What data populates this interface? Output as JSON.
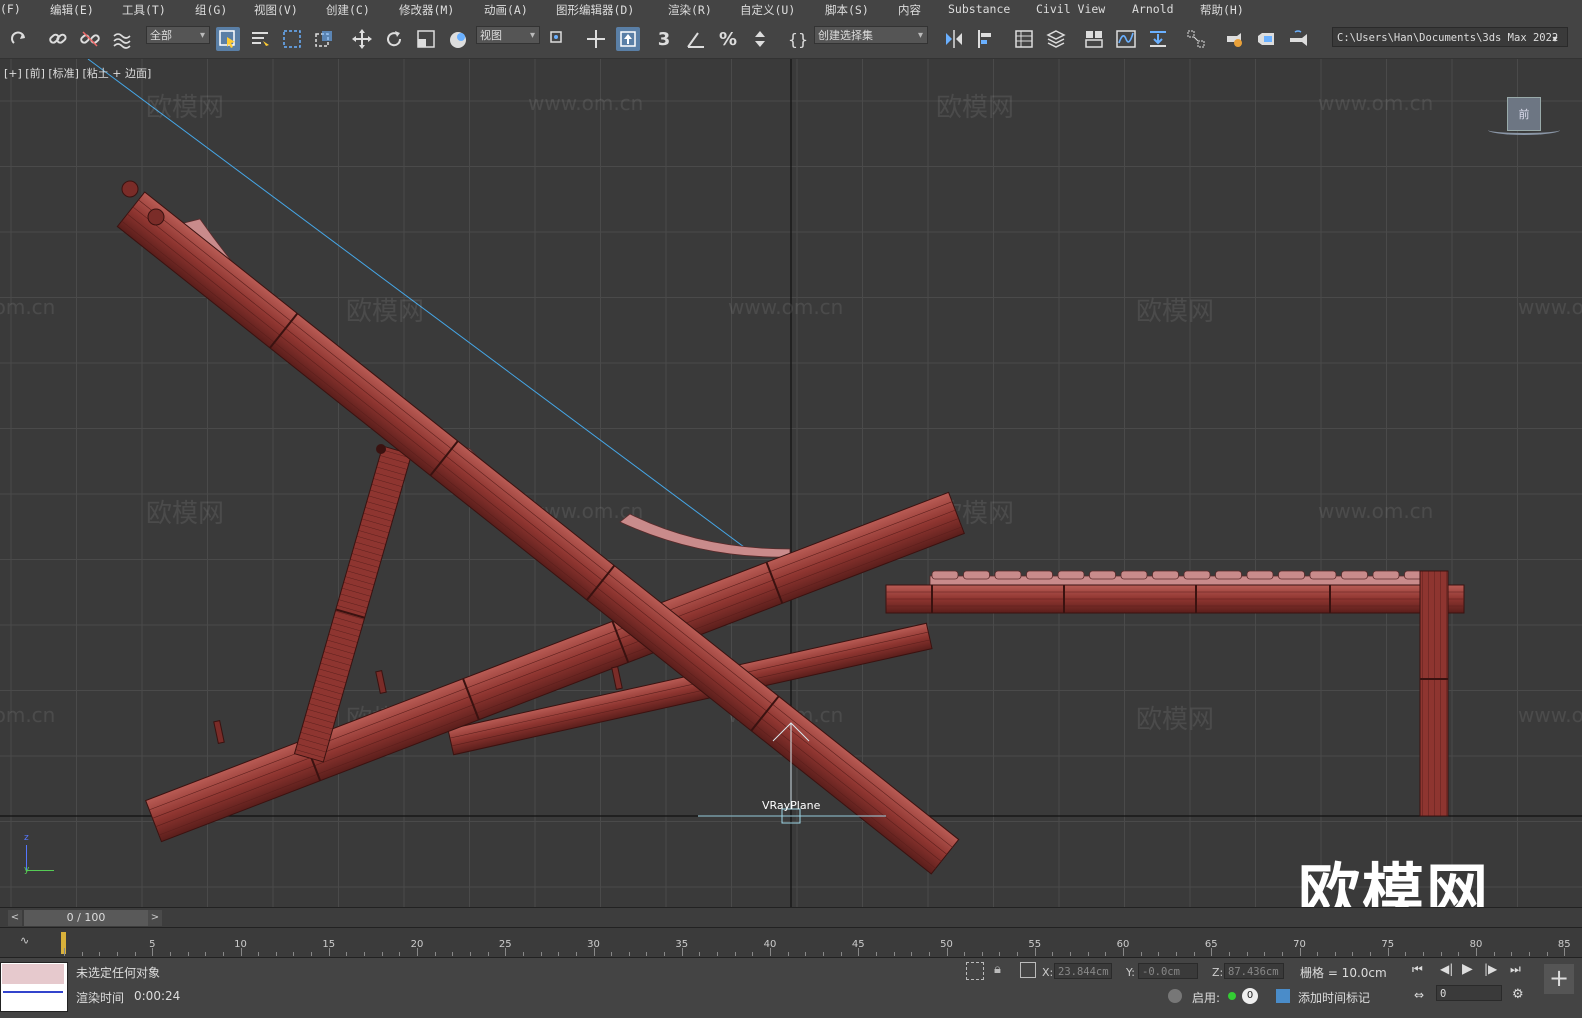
{
  "menu": [
    "(F)",
    "编辑(E)",
    "工具(T)",
    "组(G)",
    "视图(V)",
    "创建(C)",
    "修改器(M)",
    "动画(A)",
    "图形编辑器(D)",
    "渲染(R)",
    "自定义(U)",
    "脚本(S)",
    "内容",
    "Substance",
    "Civil View",
    "Arnold",
    "帮助(H)"
  ],
  "toolbar": {
    "filter": "全部",
    "ref_coord": "视图",
    "selection_set": "创建选择集",
    "project_path": "C:\\Users\\Han\\Documents\\3ds Max 2022",
    "snap_label": "3"
  },
  "viewport": {
    "label": "[+] [前] [标准] [粘土 + 边面]",
    "object_label": "VRayPlane",
    "viewcube_label": "前",
    "axis_z": "z",
    "axis_y": "y",
    "watermark_site": "www.om.cn",
    "watermark_brand": "欧模网",
    "logo": "欧模网",
    "wood_color": "#8e3530",
    "grid_color": "#4a4a4a",
    "accent": "#5a7fa6"
  },
  "timeline": {
    "frame_display": "0 / 100",
    "ticks": [
      5,
      10,
      15,
      20,
      25,
      30,
      35,
      40,
      45,
      50,
      55,
      60,
      65,
      70,
      75,
      80,
      85
    ]
  },
  "status": {
    "selection": "未选定任何对象",
    "render_time_label": "渲染时间",
    "render_time_value": "0:00:24",
    "x_label": "X:",
    "x_value": "23.844cm",
    "y_label": "Y:",
    "y_value": "-0.0cm",
    "z_label": "Z:",
    "z_value": "87.436cm",
    "grid": "栅格 = 10.0cm",
    "enable": "启用:",
    "enable_count": "0",
    "add_time_tag": "添加时间标记",
    "frame_field": "0"
  }
}
